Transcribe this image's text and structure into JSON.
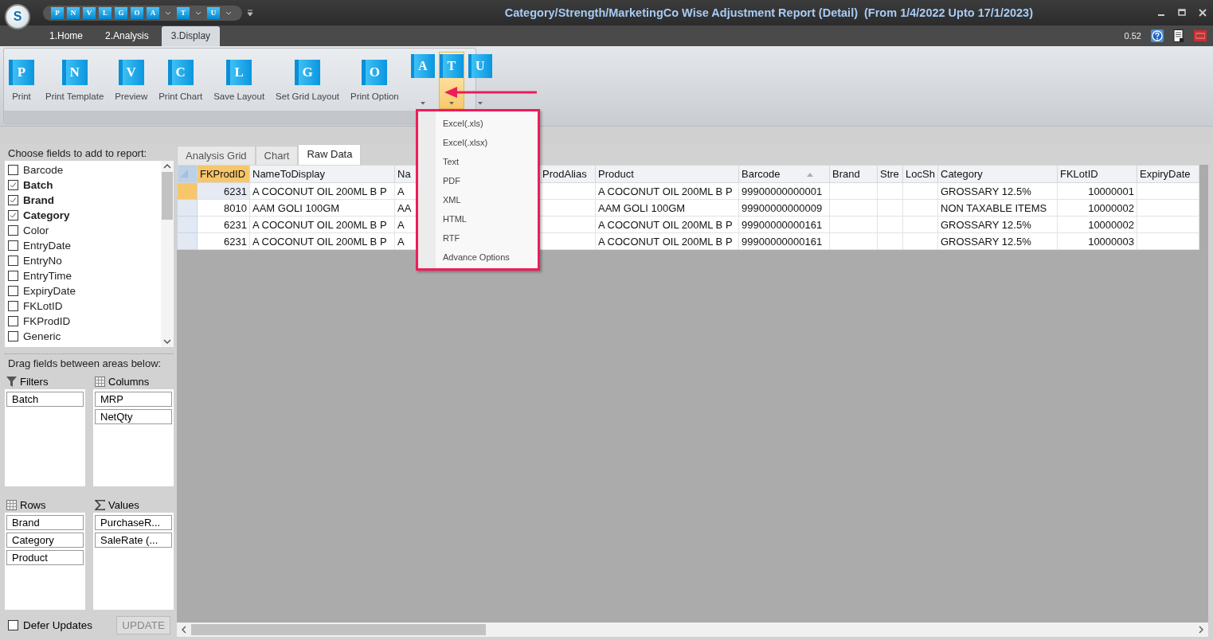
{
  "window": {
    "title": "Category/Strength/MarketingCo Wise Adjustment Report (Detail)  (From 1/4/2022 Upto 17/1/2023)",
    "logo_letter": "S"
  },
  "quick_access": [
    {
      "letter": "P",
      "dropdown": false
    },
    {
      "letter": "N",
      "dropdown": false
    },
    {
      "letter": "V",
      "dropdown": false
    },
    {
      "letter": "L",
      "dropdown": false
    },
    {
      "letter": "G",
      "dropdown": false
    },
    {
      "letter": "O",
      "dropdown": false
    },
    {
      "letter": "A",
      "dropdown": true
    },
    {
      "letter": "T",
      "dropdown": true
    },
    {
      "letter": "U",
      "dropdown": true
    }
  ],
  "tabs": [
    {
      "label": "1.Home",
      "selected": false
    },
    {
      "label": "2.Analysis",
      "selected": false
    },
    {
      "label": "3.Display",
      "selected": true
    }
  ],
  "status": {
    "zoom": "0.52"
  },
  "ribbon": {
    "buttons": [
      {
        "letter": "P",
        "label": "Print"
      },
      {
        "letter": "N",
        "label": "Print Template"
      },
      {
        "letter": "V",
        "label": "Preview"
      },
      {
        "letter": "C",
        "label": "Print Chart"
      },
      {
        "letter": "L",
        "label": "Save Layout"
      },
      {
        "letter": "G",
        "label": "Set Grid Layout"
      },
      {
        "letter": "O",
        "label": "Print Option"
      }
    ],
    "dropdown_buttons": [
      {
        "letter": "A",
        "active": false
      },
      {
        "letter": "T",
        "active": true
      },
      {
        "letter": "U",
        "active": false
      }
    ]
  },
  "export_menu": {
    "items": [
      "Excel(.xls)",
      "Excel(.xlsx)",
      "Text",
      "PDF",
      "XML",
      "HTML",
      "RTF",
      "Advance Options"
    ]
  },
  "field_list": {
    "title": "Choose fields to add to report:",
    "fields": [
      {
        "label": "Barcode",
        "checked": false
      },
      {
        "label": "Batch",
        "checked": true
      },
      {
        "label": "Brand",
        "checked": true
      },
      {
        "label": "Category",
        "checked": true
      },
      {
        "label": "Color",
        "checked": false
      },
      {
        "label": "EntryDate",
        "checked": false
      },
      {
        "label": "EntryNo",
        "checked": false
      },
      {
        "label": "EntryTime",
        "checked": false
      },
      {
        "label": "ExpiryDate",
        "checked": false
      },
      {
        "label": "FKLotID",
        "checked": false
      },
      {
        "label": "FKProdID",
        "checked": false
      },
      {
        "label": "Generic",
        "checked": false
      }
    ]
  },
  "areas_title": "Drag fields between areas below:",
  "areas": [
    {
      "kind": "filter",
      "title": "Filters",
      "fields": [
        "Batch"
      ]
    },
    {
      "kind": "columns",
      "title": "Columns",
      "fields": [
        "MRP",
        "NetQty"
      ]
    },
    {
      "kind": "rows",
      "title": "Rows",
      "fields": [
        "Brand",
        "Category",
        "Product"
      ]
    },
    {
      "kind": "sum",
      "title": "Values",
      "fields": [
        "PurchaseR...",
        "SaleRate (..."
      ]
    }
  ],
  "defer_updates": {
    "label": "Defer Updates",
    "checked": false
  },
  "update_button": {
    "label": "UPDATE",
    "disabled": true
  },
  "view_tabs": [
    {
      "label": "Analysis Grid",
      "selected": false
    },
    {
      "label": "Chart",
      "selected": false
    },
    {
      "label": "Raw Data",
      "selected": true
    }
  ],
  "grid": {
    "columns": [
      {
        "label": "FKProdID",
        "selected": true,
        "kind": "number",
        "sorted": false
      },
      {
        "label": "NameToDisplay",
        "selected": false,
        "kind": "text",
        "sorted": false
      },
      {
        "label": "Na",
        "selected": false,
        "kind": "text",
        "sorted": false
      },
      {
        "label": "ProdAlias",
        "selected": false,
        "kind": "text",
        "sorted": false
      },
      {
        "label": "Product",
        "selected": false,
        "kind": "text",
        "sorted": false
      },
      {
        "label": "Barcode",
        "selected": false,
        "kind": "text",
        "sorted": true
      },
      {
        "label": "Brand",
        "selected": false,
        "kind": "text",
        "sorted": false
      },
      {
        "label": "Stre",
        "selected": false,
        "kind": "text",
        "sorted": false
      },
      {
        "label": "LocSh",
        "selected": false,
        "kind": "text",
        "sorted": false
      },
      {
        "label": "Category",
        "selected": false,
        "kind": "text",
        "sorted": false
      },
      {
        "label": "FKLotID",
        "selected": false,
        "kind": "number",
        "sorted": false
      },
      {
        "label": "ExpiryDate",
        "selected": false,
        "kind": "text",
        "sorted": false
      }
    ],
    "rows": [
      {
        "selected": true,
        "cells": [
          "6231",
          "A COCONUT OIL 200ML B P",
          "A",
          null,
          "A COCONUT OIL 200ML B P",
          "99900000000001",
          null,
          null,
          null,
          "GROSSARY 12.5%",
          "10000001",
          null
        ]
      },
      {
        "selected": false,
        "cells": [
          "8010",
          "AAM GOLI 100GM",
          "AA",
          null,
          "AAM GOLI 100GM",
          "99900000000009",
          null,
          null,
          null,
          "NON TAXABLE ITEMS",
          "10000002",
          null
        ]
      },
      {
        "selected": false,
        "cells": [
          "6231",
          "A COCONUT OIL 200ML B P",
          "A",
          null,
          "A COCONUT OIL 200ML B P",
          "99900000000161",
          null,
          null,
          null,
          "GROSSARY 12.5%",
          "10000002",
          null
        ]
      },
      {
        "selected": false,
        "cells": [
          "6231",
          "A COCONUT OIL 200ML B P",
          "A",
          null,
          "A COCONUT OIL 200ML B P",
          "99900000000161",
          null,
          null,
          null,
          "GROSSARY 12.5%",
          "10000003",
          null
        ]
      }
    ]
  }
}
